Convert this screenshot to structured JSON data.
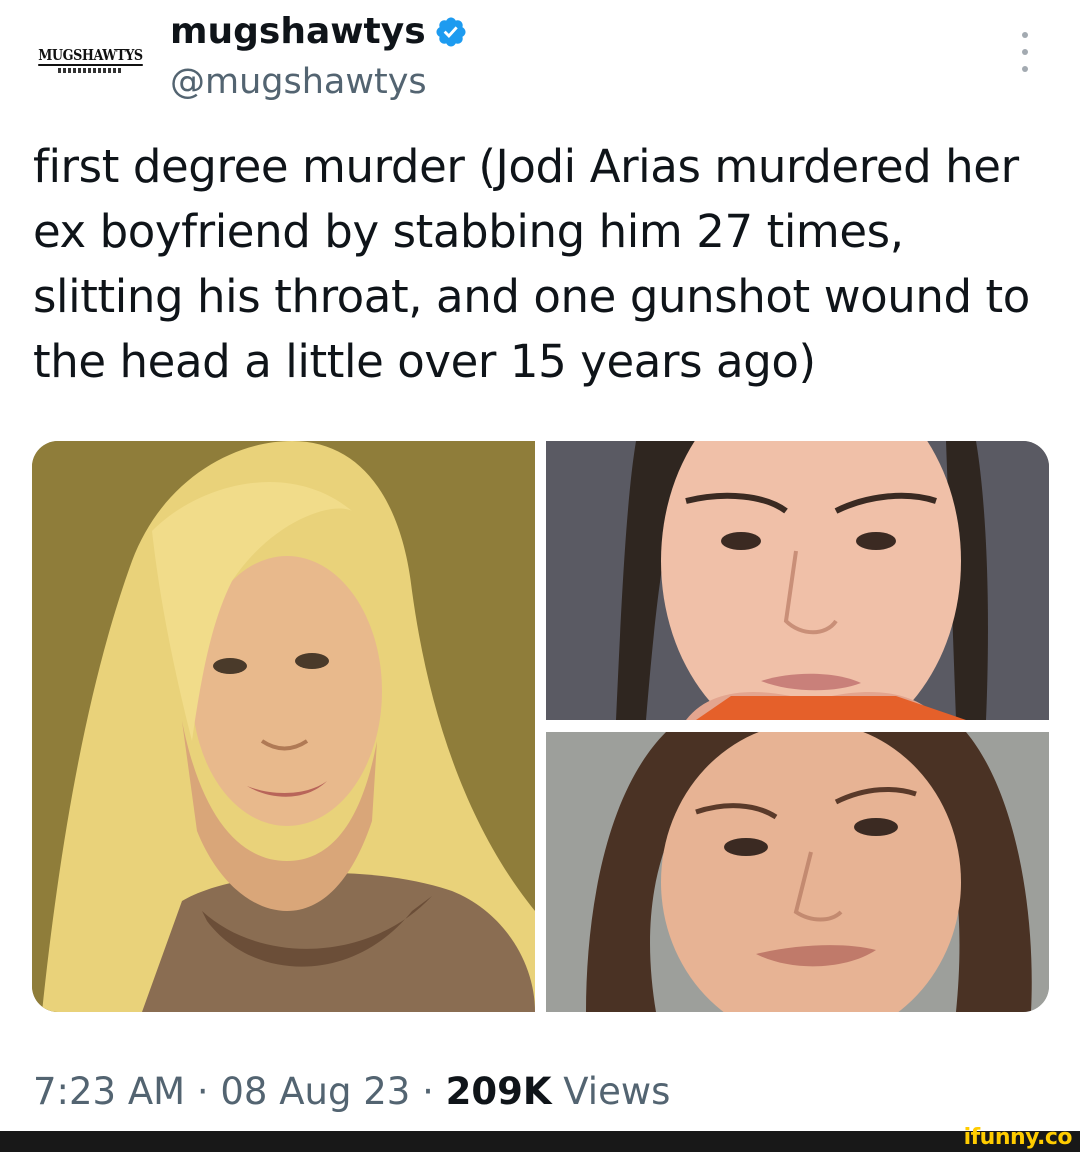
{
  "author": {
    "avatar_text": "MUGSHAWTYS",
    "display_name": "mugshawtys",
    "handle": "@mugshawtys",
    "verified": true
  },
  "tweet": {
    "text": "first degree murder (Jodi Arias murdered her ex boyfriend by stabbing him 27 times, slitting his throat, and one gunshot wound to the head a little over 15 years ago)"
  },
  "media": {
    "photos": [
      "photo-blonde-portrait",
      "photo-mugshot-1",
      "photo-mugshot-2"
    ]
  },
  "meta": {
    "time": "7:23 AM",
    "sep1": " · ",
    "date": "08 Aug 23",
    "sep2": " · ",
    "views_count": "209K",
    "views_label": " Views"
  },
  "watermark": {
    "text": "ifunny.co"
  },
  "colors": {
    "verified": "#1d9bf0",
    "text_primary": "#0f1419",
    "text_secondary": "#536471",
    "watermark": "#ffcc00"
  }
}
